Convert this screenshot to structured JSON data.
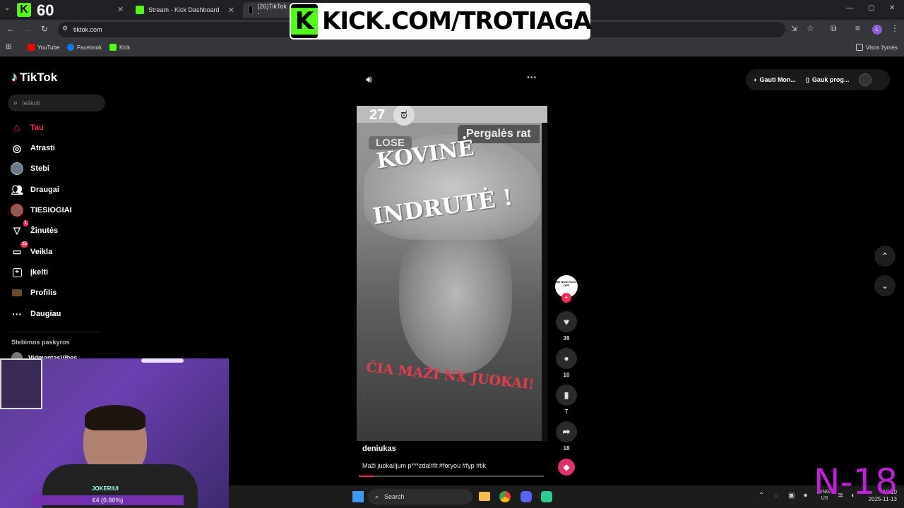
{
  "browser": {
    "tabs": [
      {
        "label": "60",
        "type": "kick-counter"
      },
      {
        "label": "Stream - Kick Dashboard"
      },
      {
        "label": "(26)TikTok -"
      }
    ],
    "url": "tiktok.com",
    "bookmarks": [
      {
        "label": "YouTube"
      },
      {
        "label": "Facebook"
      },
      {
        "label": "Kick"
      }
    ],
    "all_bookmarks": "Visos žymės",
    "profile_initial": "L"
  },
  "banner": {
    "text": "KICK.COM/TROTIAGA"
  },
  "tiktok": {
    "logo": "TikTok",
    "search_placeholder": "Ieškoti",
    "nav": [
      {
        "label": "Tau",
        "icon": "home-icon",
        "active": true
      },
      {
        "label": "Atrasti",
        "icon": "compass-icon"
      },
      {
        "label": "Stebi",
        "icon": "avatar-icon"
      },
      {
        "label": "Draugai",
        "icon": "friends-icon"
      },
      {
        "label": "TIESIOGIAI",
        "icon": "live-avatar-icon"
      },
      {
        "label": "Žinutės",
        "icon": "inbox-icon",
        "badge": "1"
      },
      {
        "label": "Veikla",
        "icon": "activity-icon",
        "badge": "25"
      },
      {
        "label": "Įkelti",
        "icon": "upload-icon"
      },
      {
        "label": "Profilis",
        "icon": "profile-icon"
      },
      {
        "label": "Daugiau",
        "icon": "more-icon"
      }
    ],
    "following_title": "Stebimos paskyros",
    "following": [
      {
        "name": "VidmantasVibes"
      }
    ],
    "top_right": {
      "coins": "Gauti Mon...",
      "app": "Gauk prog..."
    },
    "video": {
      "counter": "27",
      "lose": "LOSE",
      "win_label": "Pergalės rat",
      "overlay_top1": "KOVINĖ",
      "overlay_top2": "INDRUTĖ !",
      "overlay_bottom": "ČIA MAŽI NX JUOKAI!",
      "author": "deniukas",
      "caption": "Maži juokai!jum p***zda!#lt #foryou #fyp #tik",
      "avatar_text": "BE NICE FUCK OFF"
    },
    "actions": [
      {
        "name": "like",
        "count": "39"
      },
      {
        "name": "comment",
        "count": "10"
      },
      {
        "name": "save",
        "count": "7"
      },
      {
        "name": "share",
        "count": "18"
      }
    ]
  },
  "webcam": {
    "label": "JOKERIUI",
    "sub": "€4 (0.80%)"
  },
  "watermark": "N-18",
  "taskbar": {
    "search": "Search",
    "lang": "ENG",
    "region": "US",
    "time": "10:10",
    "date": "2025-11-13"
  }
}
